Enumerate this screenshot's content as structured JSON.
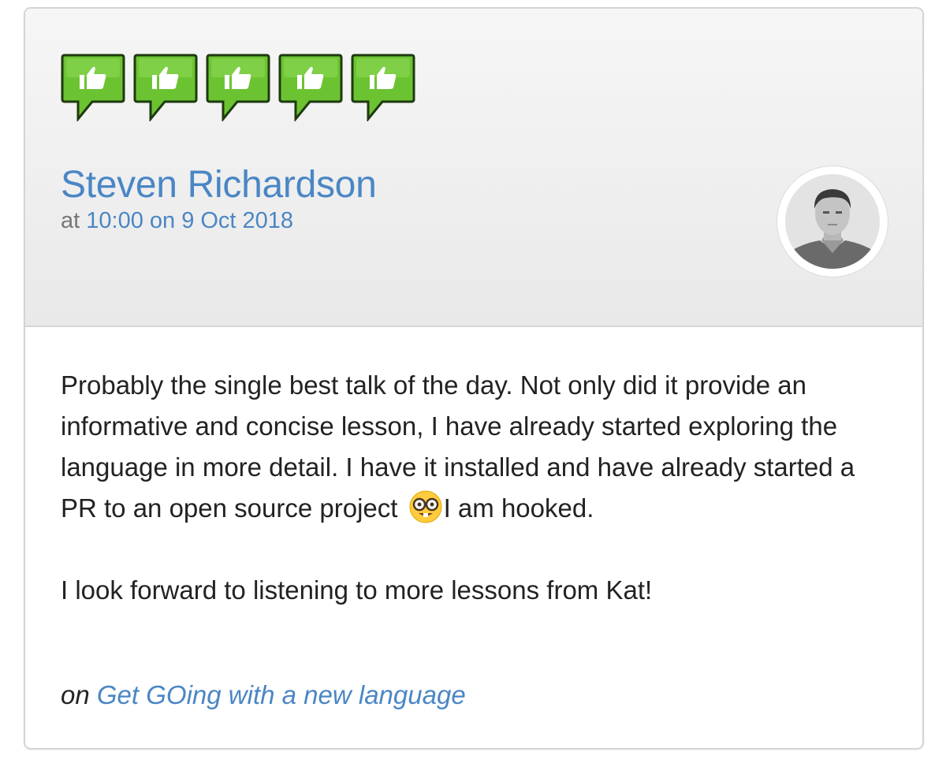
{
  "rating": {
    "value": 5,
    "max": 5,
    "icon": "thumbs-up-speech-bubble-icon",
    "color": "#6cc332"
  },
  "author": {
    "name": "Steven Richardson"
  },
  "timestamp": {
    "prefix": "at",
    "when": "10:00 on 9 Oct 2018"
  },
  "review": {
    "paragraph1_before_emoji": "Probably the single best talk of the day. Not only did it provide an informative and concise lesson, I have already started exploring the language in more detail. I have it installed and have already started a PR to an open source project ",
    "emoji": "nerd-face-emoji",
    "paragraph1_after_emoji": "I am hooked.",
    "paragraph2": "I look forward to listening to more lessons from Kat!"
  },
  "talk": {
    "prefix": "on",
    "title": "Get GOing with a new language"
  },
  "colors": {
    "link": "#4a86c5",
    "header_bg": "#ececec",
    "text": "#222222",
    "muted": "#777777"
  }
}
